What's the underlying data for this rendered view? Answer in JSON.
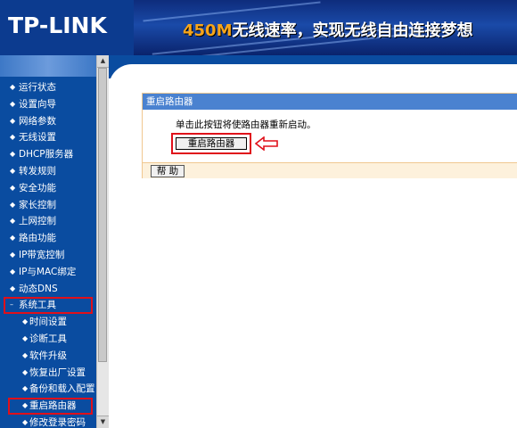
{
  "header": {
    "logo": "TP-LINK",
    "slogan_highlight": "450M",
    "slogan_rest": "无线速率，实现无线自由连接梦想"
  },
  "sidebar": {
    "items": [
      {
        "label": "运行状态",
        "bullet": "◆"
      },
      {
        "label": "设置向导",
        "bullet": "◆"
      },
      {
        "label": "网络参数",
        "bullet": "◆"
      },
      {
        "label": "无线设置",
        "bullet": "◆"
      },
      {
        "label": "DHCP服务器",
        "bullet": "◆"
      },
      {
        "label": "转发规则",
        "bullet": "◆"
      },
      {
        "label": "安全功能",
        "bullet": "◆"
      },
      {
        "label": "家长控制",
        "bullet": "◆"
      },
      {
        "label": "上网控制",
        "bullet": "◆"
      },
      {
        "label": "路由功能",
        "bullet": "◆"
      },
      {
        "label": "IP带宽控制",
        "bullet": "◆"
      },
      {
        "label": "IP与MAC绑定",
        "bullet": "◆"
      },
      {
        "label": "动态DNS",
        "bullet": "◆"
      },
      {
        "label": "系统工具",
        "bullet": "–"
      },
      {
        "label": "时间设置",
        "bullet": "◆"
      },
      {
        "label": "诊断工具",
        "bullet": "◆"
      },
      {
        "label": "软件升级",
        "bullet": "◆"
      },
      {
        "label": "恢复出厂设置",
        "bullet": "◆"
      },
      {
        "label": "备份和载入配置",
        "bullet": "◆"
      },
      {
        "label": "重启路由器",
        "bullet": "◆"
      },
      {
        "label": "修改登录密码",
        "bullet": "◆"
      }
    ]
  },
  "scrollbar": {
    "up": "▲",
    "down": "▼"
  },
  "panel": {
    "title": "重启路由器",
    "description": "单击此按钮将使路由器重新启动。",
    "reboot_label": "重启路由器",
    "help_label": "帮 助"
  },
  "colors": {
    "sidebar_bg": "#0a4ca0",
    "panel_title_bg": "#4a82d0",
    "highlight_red": "#e0101a",
    "slogan_accent": "#f6a51b"
  }
}
